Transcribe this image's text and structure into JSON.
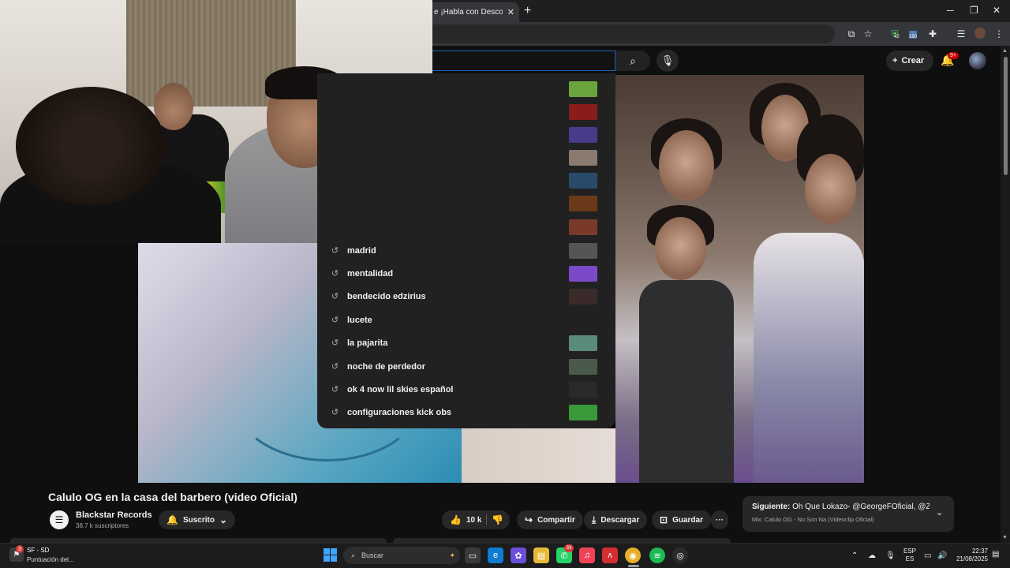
{
  "browser": {
    "tab_title": "e ¡Habla con Desconoc",
    "tab_close": "✕",
    "new_tab": "+",
    "window_controls": [
      "─",
      "❐",
      "✕"
    ],
    "ext_badge_1": "42",
    "ext_badge_2": "220"
  },
  "masthead": {
    "create_label": "Crear",
    "notifications_badge": "9+"
  },
  "search_suggestions": [
    {
      "text": "",
      "thumb": "#6aa53c"
    },
    {
      "text": "",
      "thumb": "#8a1c1c"
    },
    {
      "text": "",
      "thumb": "#4a3a8c"
    },
    {
      "text": "",
      "thumb": "#8a7a70"
    },
    {
      "text": "",
      "thumb": "#2a4a6a"
    },
    {
      "text": "",
      "thumb": "#6a3a1a"
    },
    {
      "text": "",
      "thumb": "#7a3a2a"
    },
    {
      "text": "madrid",
      "thumb": "#555555"
    },
    {
      "text": "mentalidad",
      "thumb": "#7a4ac8"
    },
    {
      "text": "bendecido edzirius",
      "thumb": "#3a2a2a"
    },
    {
      "text": "lucete",
      "thumb": ""
    },
    {
      "text": "la pajarita",
      "thumb": "#5a8a7a"
    },
    {
      "text": "noche de perdedor",
      "thumb": "#4a5a4a"
    },
    {
      "text": "ok 4 now lil skies español",
      "thumb": "#2a2a2a"
    },
    {
      "text": "configuraciones kick obs",
      "thumb": "#3a9a3a"
    }
  ],
  "video": {
    "title": "Calulo OG en la casa del barbero (video Oficial)",
    "channel_name": "Blackstar Records",
    "subscribers": "38.7 k suscriptores",
    "subscribed_label": "Suscrito",
    "likes": "10 k",
    "share_label": "Compartir",
    "download_label": "Descargar",
    "save_label": "Guardar",
    "more": "···"
  },
  "up_next": {
    "prefix": "Siguiente:",
    "title": "Oh Que Lokazo- @GeorgeFOficial, @Zim...",
    "mix": "Mix: Calulo OG - No Son Na (Videoclip Oficial)"
  },
  "taskbar": {
    "weather_line1": "SF - SD",
    "weather_line2": "Puntuación del...",
    "weather_badge": "3",
    "search_label": "Buscar",
    "whatsapp_badge": "33",
    "lang_line1": "ESP",
    "lang_line2": "ES",
    "time": "22:37",
    "date": "21/08/2025"
  },
  "colors": {
    "background": "#0f0f0f",
    "accent_blue": "#3ea6ff",
    "badge_red": "#cc0000"
  }
}
